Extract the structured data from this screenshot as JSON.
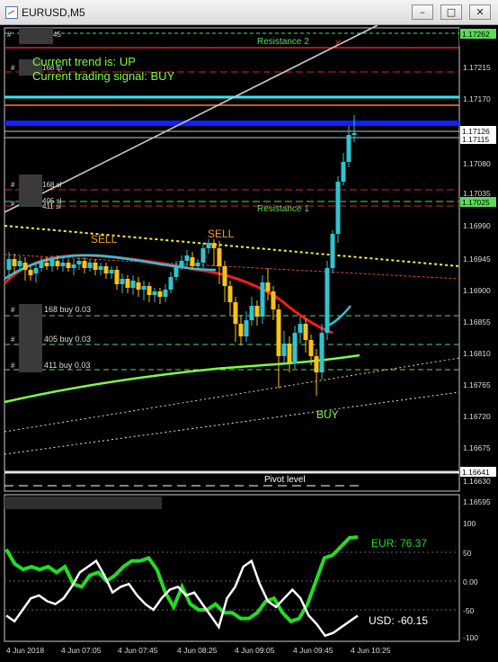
{
  "window": {
    "title": "EURUSD,M5",
    "minimize_label": "–",
    "maximize_label": "□",
    "close_label": "✕"
  },
  "indicator_text": {
    "trend": "Current trend is: UP",
    "signal": "Current trading signal: BUY"
  },
  "annotations": {
    "resistance2": "Resistance 2",
    "resistance1": "Resistance 1",
    "pivot": "Pivot level",
    "sell1": "SELL",
    "sell2": "SELL",
    "buy": "BUY"
  },
  "order_labels": {
    "hash": "#",
    "top_fragment": "45",
    "tp": "168 tp",
    "sl1": "168 sl",
    "sl2": "405 sl",
    "sl3": "411 sl",
    "buy1": "168 buy 0.03",
    "buy2": "405 buy 0.03",
    "buy3": "411 buy 0.03"
  },
  "price_axis": {
    "labels": [
      "1.17262",
      "1.17215",
      "1.17170",
      "1.17126",
      "1.17115",
      "1.17080",
      "1.17035",
      "1.17025",
      "1.16990",
      "1.16945",
      "1.16900",
      "1.16855",
      "1.16810",
      "1.16765",
      "1.16720",
      "1.16675",
      "1.16641",
      "1.16630"
    ],
    "highlight_top": "1.17262",
    "highlight_r1": "1.17025",
    "current_white1": "1.17126",
    "current_white2": "1.17115",
    "pivot_label": "1.16641"
  },
  "sub_axis": {
    "labels": [
      "1.16595",
      "100",
      "50",
      "0.00",
      "-50",
      "-100"
    ]
  },
  "time_axis": {
    "labels": [
      "4 Jun 2018",
      "4 Jun 07:05",
      "4 Jun 07:45",
      "4 Jun 08:25",
      "4 Jun 09:05",
      "4 Jun 09:45",
      "4 Jun 10:25"
    ]
  },
  "currency_strength": {
    "eur_label": "EUR: 76.37",
    "usd_label": "USD: -60.15",
    "eur_color": "#22dd22",
    "usd_color": "#ffffff",
    "eur_values": [
      55,
      30,
      20,
      25,
      20,
      25,
      15,
      25,
      -5,
      -10,
      10,
      15,
      0,
      10,
      25,
      35,
      35,
      40,
      20,
      -20,
      -45,
      -10,
      -40,
      -50,
      -50,
      -40,
      -55,
      -55,
      -65,
      -65,
      -55,
      -35,
      -30,
      -55,
      -70,
      -65,
      -40,
      0,
      40,
      45,
      60,
      75,
      76.37
    ],
    "usd_values": [
      -60,
      -70,
      -50,
      -30,
      -25,
      -35,
      -40,
      -30,
      -10,
      15,
      25,
      35,
      10,
      -20,
      -10,
      -5,
      -25,
      -40,
      -50,
      -30,
      -15,
      -10,
      -25,
      -20,
      -40,
      -60,
      -80,
      -30,
      -10,
      25,
      35,
      -5,
      -35,
      -45,
      -30,
      -15,
      -30,
      -60,
      -75,
      -95,
      -90,
      -80,
      -70,
      -60.15
    ]
  },
  "colors": {
    "resistance": "#e0241c",
    "support_dash": "#5adc5a",
    "cyan_line": "#3ce6f0",
    "blue_line": "#1020ff",
    "orange_line": "#ff7a22",
    "ma_red": "#ff1a1a",
    "ma_cyan": "#28c4d8",
    "ma_green": "#7cff3c",
    "trend_yellow": "#f7f03a",
    "candle_bull": "#2fc4d0",
    "candle_bear": "#f7c21a",
    "text_green": "#7cff3c",
    "text_orange": "#ff9a2a"
  }
}
